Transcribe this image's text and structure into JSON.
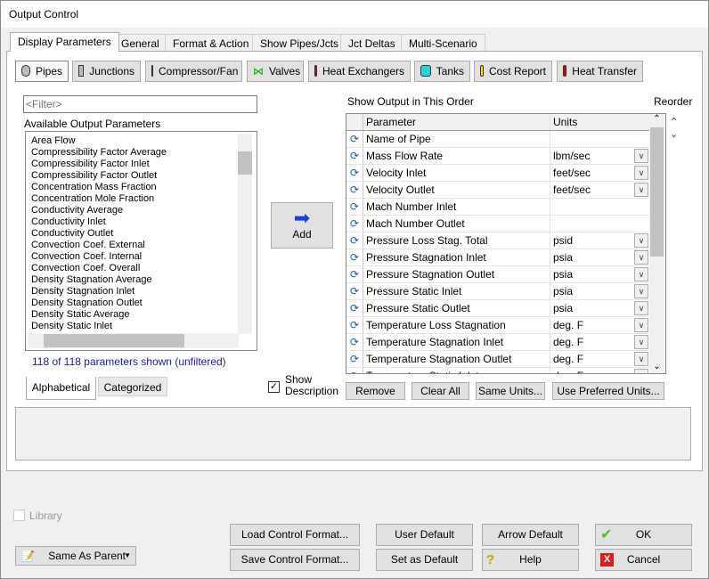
{
  "window": {
    "title": "Output Control"
  },
  "tabs": [
    "Display Parameters",
    "General",
    "Format & Action",
    "Show Pipes/Jcts",
    "Jct Deltas",
    "Multi-Scenario"
  ],
  "toolbar": [
    {
      "label": "Pipes",
      "icon": "pipe-icon"
    },
    {
      "label": "Junctions",
      "icon": "junction-icon"
    },
    {
      "label": "Compressor/Fan",
      "icon": "compressor-icon"
    },
    {
      "label": "Valves",
      "icon": "valve-icon"
    },
    {
      "label": "Heat Exchangers",
      "icon": "heat-exchanger-icon"
    },
    {
      "label": "Tanks",
      "icon": "tank-icon"
    },
    {
      "label": "Cost Report",
      "icon": "cost-report-icon"
    },
    {
      "label": "Heat Transfer",
      "icon": "heat-transfer-icon"
    }
  ],
  "filter": {
    "placeholder": "<Filter>"
  },
  "available": {
    "label": "Available Output Parameters",
    "items": [
      "Area Flow",
      "Compressibility Factor Average",
      "Compressibility Factor Inlet",
      "Compressibility Factor Outlet",
      "Concentration Mass Fraction",
      "Concentration Mole Fraction",
      "Conductivity Average",
      "Conductivity Inlet",
      "Conductivity Outlet",
      "Convection Coef. External",
      "Convection Coef. Internal",
      "Convection Coef. Overall",
      "Density Stagnation Average",
      "Density Stagnation Inlet",
      "Density Stagnation Outlet",
      "Density Static Average",
      "Density Static Inlet"
    ],
    "status": "118 of 118 parameters shown (unfiltered)",
    "status_color": "#1a1aa6"
  },
  "sort_tabs": [
    "Alphabetical",
    "Categorized"
  ],
  "add_label": "Add",
  "show_description": {
    "label": "Show Description",
    "checked": true
  },
  "output": {
    "label": "Show Output in This Order",
    "reorder": "Reorder",
    "headers": [
      "Parameter",
      "Units"
    ],
    "rows": [
      [
        "Name of Pipe",
        ""
      ],
      [
        "Mass Flow Rate",
        "lbm/sec"
      ],
      [
        "Velocity Inlet",
        "feet/sec"
      ],
      [
        "Velocity Outlet",
        "feet/sec"
      ],
      [
        "Mach Number Inlet",
        ""
      ],
      [
        "Mach Number Outlet",
        ""
      ],
      [
        "Pressure Loss Stag. Total",
        "psid"
      ],
      [
        "Pressure Stagnation Inlet",
        "psia"
      ],
      [
        "Pressure Stagnation Outlet",
        "psia"
      ],
      [
        "Pressure Static Inlet",
        "psia"
      ],
      [
        "Pressure Static Outlet",
        "psia"
      ],
      [
        "Temperature Loss Stagnation",
        "deg. F"
      ],
      [
        "Temperature Stagnation Inlet",
        "deg. F"
      ],
      [
        "Temperature Stagnation Outlet",
        "deg. F"
      ],
      [
        "Temperature Static Inlet",
        "deg. F"
      ]
    ]
  },
  "grid_buttons": [
    "Remove",
    "Clear All",
    "Same Units...",
    "Use Preferred Units..."
  ],
  "library": {
    "label": "Library",
    "checked": false
  },
  "same_as_parent": "Same As Parent",
  "buttons": {
    "load": "Load Control Format...",
    "save": "Save Control Format...",
    "user_default": "User Default",
    "set_default": "Set as Default",
    "arrow_default": "Arrow Default",
    "help": "Help",
    "ok": "OK",
    "cancel": "Cancel"
  }
}
